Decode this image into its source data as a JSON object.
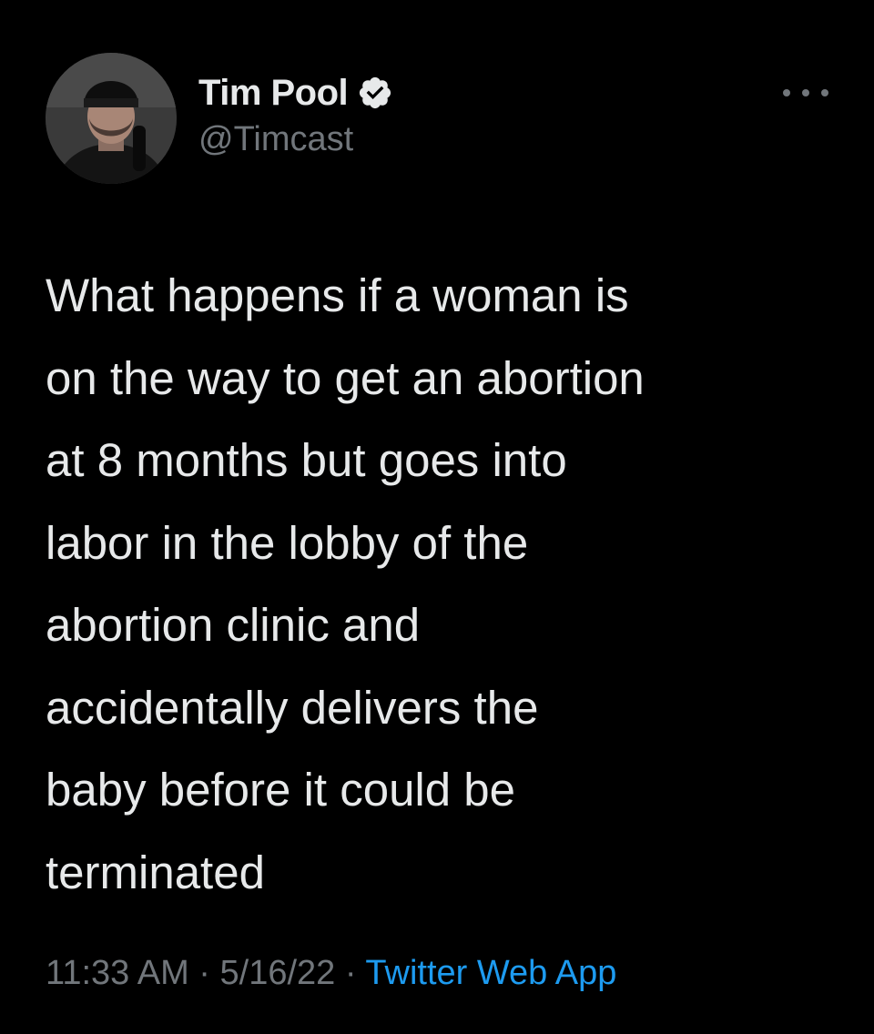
{
  "author": {
    "display_name": "Tim Pool",
    "handle": "@Timcast",
    "verified": true,
    "avatar_icon": "profile-photo"
  },
  "tweet": {
    "text": "What happens if a woman is\non the way to get an abortion\nat 8 months but goes into\nlabor in the lobby of the\nabortion clinic and\naccidentally delivers the\nbaby before it could be\nterminated",
    "time": "11:33 AM",
    "separator": "·",
    "date": "5/16/22",
    "source": "Twitter Web App"
  },
  "icons": {
    "more": "more-options-icon",
    "verified": "verified-badge-icon"
  },
  "colors": {
    "background": "#000000",
    "text_primary": "#e7e9ea",
    "text_secondary": "#71767b",
    "accent": "#1d9bf0"
  }
}
